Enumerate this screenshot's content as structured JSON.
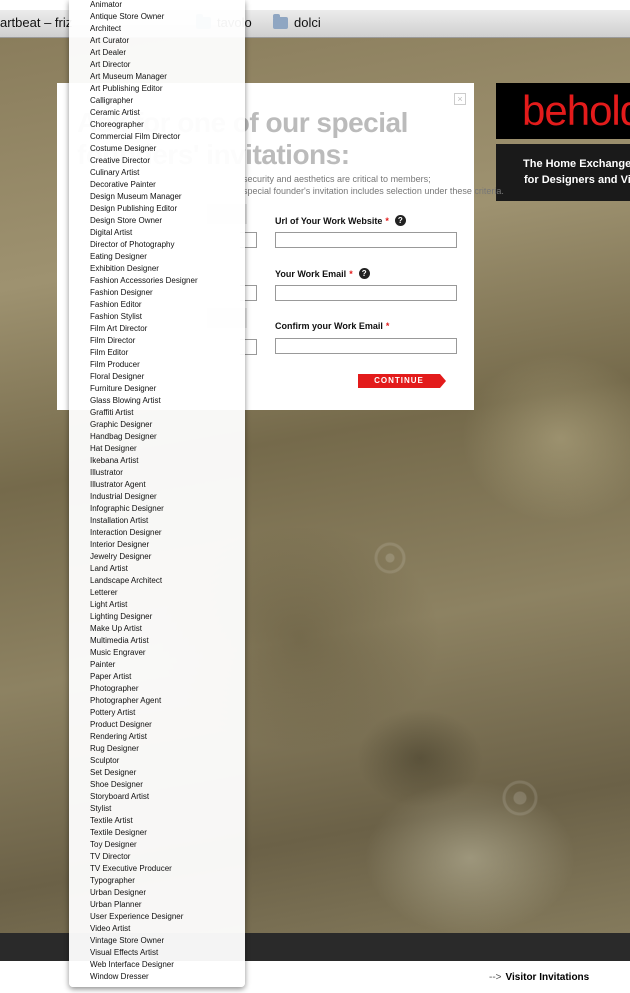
{
  "bookmarks": {
    "item1": "artbeat – friz",
    "item2": "tavolo",
    "item3": "dolci"
  },
  "modal": {
    "close": "×",
    "heading_line1": "Ask for one of our special",
    "heading_line2": "founders' invitations:",
    "subtext_line1": "security and aesthetics are critical to members;",
    "subtext_line2": "special founder's invitation includes selection under these criteria.",
    "field1_label": "Url of Your Work Website",
    "field2_label": "Your Work Email",
    "field3_label": "Confirm your Work Email",
    "required_mark": "*",
    "help_mark": "?",
    "continue_label": "CONTINUE"
  },
  "logo": {
    "text": "behold",
    "tagline1": "The Home Exchange",
    "tagline2": "for Designers and Visitors"
  },
  "footer": {
    "arrow": "-->",
    "visitor_link": "Visitor Invitations"
  },
  "dropdown": {
    "options": [
      "Animator",
      "Antique Store Owner",
      "Architect",
      "Art Curator",
      "Art Dealer",
      "Art Director",
      "Art Museum Manager",
      "Art Publishing Editor",
      "Calligrapher",
      "Ceramic Artist",
      "Choreographer",
      "Commercial Film Director",
      "Costume Designer",
      "Creative Director",
      "Culinary Artist",
      "Decorative Painter",
      "Design Museum Manager",
      "Design Publishing Editor",
      "Design Store Owner",
      "Digital Artist",
      "Director of Photography",
      "Eating Designer",
      "Exhibition Designer",
      "Fashion Accessories Designer",
      "Fashion Designer",
      "Fashion Editor",
      "Fashion Stylist",
      "Film Art Director",
      "Film Director",
      "Film Editor",
      "Film Producer",
      "Floral Designer",
      "Furniture Designer",
      "Glass Blowing Artist",
      "Graffiti Artist",
      "Graphic Designer",
      "Handbag Designer",
      "Hat Designer",
      "Ikebana Artist",
      "Illustrator",
      "Illustrator Agent",
      "Industrial Designer",
      "Infographic Designer",
      "Installation Artist",
      "Interaction Designer",
      "Interior Designer",
      "Jewelry Designer",
      "Land Artist",
      "Landscape Architect",
      "Letterer",
      "Light Artist",
      "Lighting Designer",
      "Make Up Artist",
      "Multimedia Artist",
      "Music Engraver",
      "Painter",
      "Paper Artist",
      "Photographer",
      "Photographer Agent",
      "Pottery Artist",
      "Product Designer",
      "Rendering Artist",
      "Rug Designer",
      "Sculptor",
      "Set Designer",
      "Shoe Designer",
      "Storyboard Artist",
      "Stylist",
      "Textile Artist",
      "Textile Designer",
      "Toy Designer",
      "TV Director",
      "TV Executive Producer",
      "Typographer",
      "Urban Designer",
      "Urban Planner",
      "User Experience Designer",
      "Video Artist",
      "Vintage Store Owner",
      "Visual Effects Artist",
      "Web Interface Designer",
      "Window Dresser"
    ]
  }
}
